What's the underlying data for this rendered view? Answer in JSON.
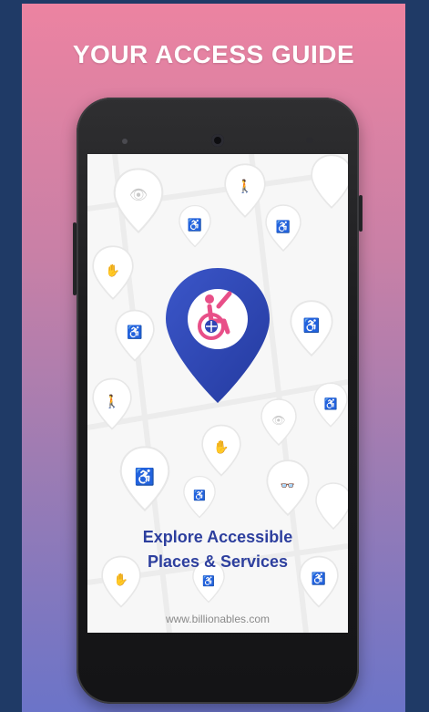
{
  "headline": "YOUR ACCESS GUIDE",
  "screen": {
    "tagline_line1": "Explore Accessible",
    "tagline_line2": "Places & Services",
    "website": "www.billionables.com"
  },
  "icons": {
    "logo": "wheelchair-location-pin-icon",
    "background": [
      "location-pin-icon",
      "wheelchair-icon",
      "person-icon",
      "accessible-icon",
      "eye-icon",
      "glasses-icon",
      "ear-icon",
      "elderly-icon",
      "sign-language-icon"
    ]
  },
  "colors": {
    "brand_blue": "#2f45b5",
    "brand_pink": "#e84f88",
    "tagline": "#2d3f9e",
    "gradient_top": "#ec83a1",
    "gradient_bottom": "#6b74c8"
  }
}
